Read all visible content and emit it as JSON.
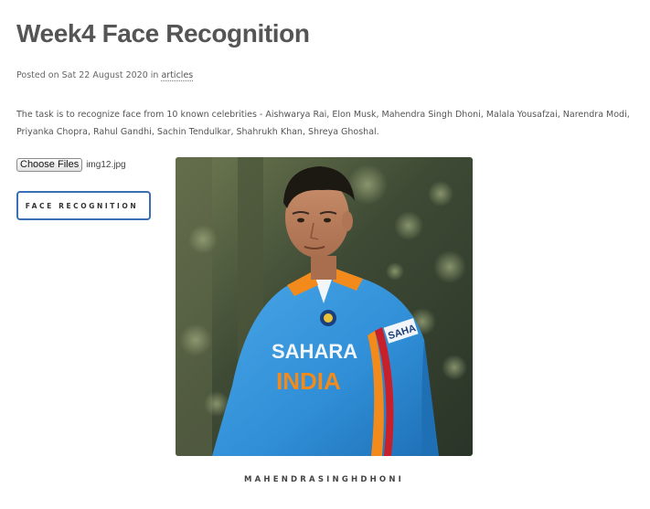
{
  "post": {
    "title": "Week4 Face Recognition",
    "meta_prefix": "Posted on Sat 22 August 2020 in ",
    "category_link": "articles",
    "description": "The task is to recognize face from 10 known celebrities - Aishwarya Rai, Elon Musk, Mahendra Singh Dhoni, Malala Yousafzai, Narendra Modi, Priyanka Chopra, Rahul Gandhi, Sachin Tendulkar, Shahrukh Khan, Shreya Ghoshal."
  },
  "upload": {
    "choose_label": "Choose Files",
    "file_name": "img12.jpg"
  },
  "action": {
    "button_label": "FACE RECOGNITION"
  },
  "result": {
    "jersey_text_line1": "SAHARA",
    "jersey_text_line2": "INDIA",
    "sleeve_text": "SAHA",
    "caption": "MAHENDRASINGHDHONI"
  },
  "colors": {
    "button_border": "#3a6fb5",
    "jersey_blue": "#2f8ed6",
    "jersey_orange": "#f28a1c",
    "background_green": "#3d4a30"
  }
}
